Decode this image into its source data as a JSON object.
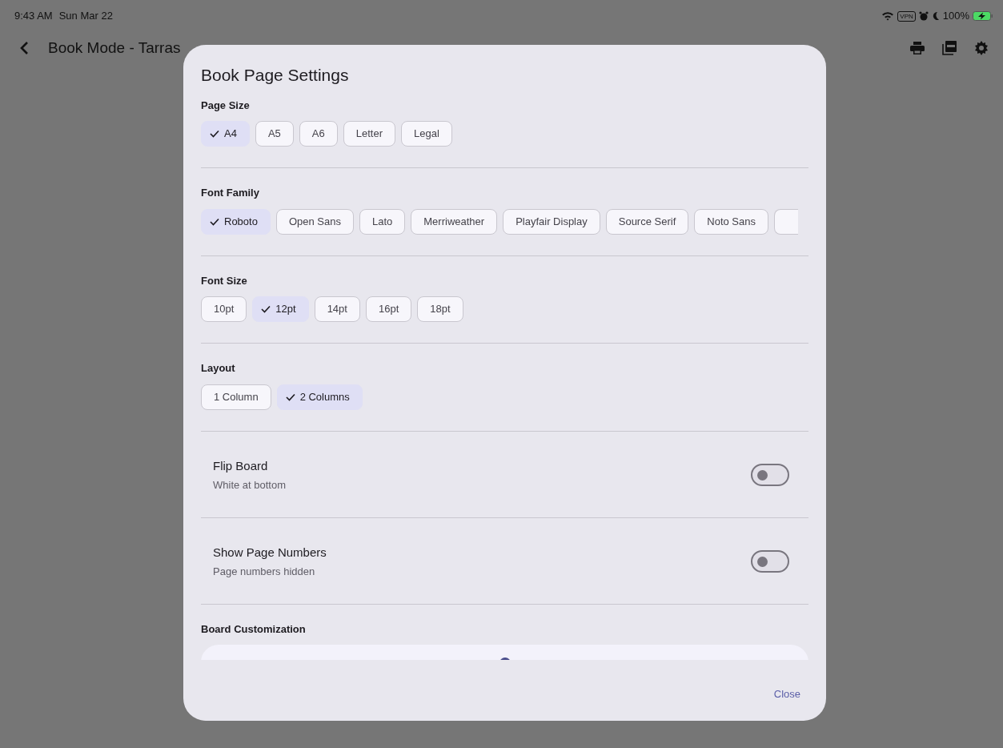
{
  "status_bar": {
    "time": "9:43 AM",
    "date": "Sun Mar 22",
    "vpn": "VPN",
    "battery": "100%",
    "charging": true
  },
  "app_bar": {
    "title": "Book Mode - Tarras"
  },
  "dialog": {
    "title": "Book Page Settings",
    "sections": [
      {
        "kind": "chips",
        "heading": "Page Size",
        "options": [
          {
            "label": "A4",
            "selected": true
          },
          {
            "label": "A5",
            "selected": false
          },
          {
            "label": "A6",
            "selected": false
          },
          {
            "label": "Letter",
            "selected": false
          },
          {
            "label": "Legal",
            "selected": false
          }
        ]
      },
      {
        "kind": "chips",
        "heading": "Font Family",
        "options": [
          {
            "label": "Roboto",
            "selected": true
          },
          {
            "label": "Open Sans",
            "selected": false
          },
          {
            "label": "Lato",
            "selected": false
          },
          {
            "label": "Merriweather",
            "selected": false
          },
          {
            "label": "Playfair Display",
            "selected": false
          },
          {
            "label": "Source Serif",
            "selected": false
          },
          {
            "label": "Noto Sans",
            "selected": false
          }
        ]
      },
      {
        "kind": "chips",
        "heading": "Font Size",
        "options": [
          {
            "label": "10pt",
            "selected": false
          },
          {
            "label": "12pt",
            "selected": true
          },
          {
            "label": "14pt",
            "selected": false
          },
          {
            "label": "16pt",
            "selected": false
          },
          {
            "label": "18pt",
            "selected": false
          }
        ]
      },
      {
        "kind": "chips",
        "heading": "Layout",
        "options": [
          {
            "label": "1 Column",
            "selected": false
          },
          {
            "label": "2 Columns",
            "selected": true
          }
        ]
      },
      {
        "kind": "switch",
        "label": "Flip Board",
        "subtitle": "White at bottom",
        "on": false
      },
      {
        "kind": "switch",
        "label": "Show Page Numbers",
        "subtitle": "Page numbers hidden",
        "on": false
      },
      {
        "kind": "board",
        "heading": "Board Customization"
      }
    ],
    "close": "Close"
  }
}
